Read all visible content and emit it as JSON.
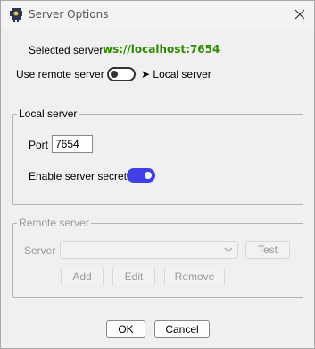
{
  "window": {
    "title": "Server Options",
    "close_glyph": "✕"
  },
  "selected": {
    "label": "Selected server",
    "url": "ws://localhost:7654"
  },
  "remote_toggle": {
    "label": "Use remote server",
    "state": "off",
    "result_text": "➤ Local server"
  },
  "local_group": {
    "title": "Local server",
    "port_label": "Port",
    "port_value": "7654",
    "secrets_label": "Enable server secrets",
    "secrets_state": "on"
  },
  "remote_group": {
    "title": "Remote server",
    "server_label": "Server",
    "server_value": "",
    "test_label": "Test",
    "add_label": "Add",
    "edit_label": "Edit",
    "remove_label": "Remove"
  },
  "footer": {
    "ok_label": "OK",
    "cancel_label": "Cancel"
  },
  "colors": {
    "url_green": "#2e8b00",
    "toggle_on": "#4040e8"
  }
}
